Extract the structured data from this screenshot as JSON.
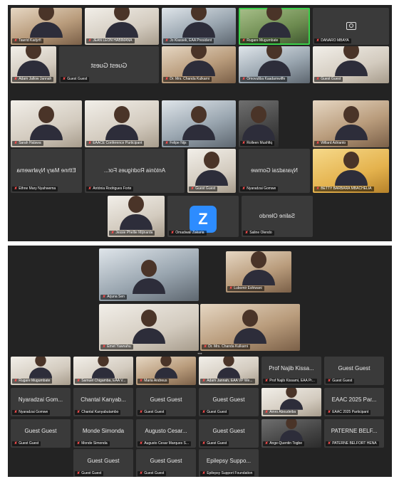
{
  "top_gallery": {
    "tiles": [
      {
        "name": "Tawrid Kadyrfi",
        "name_style": "video",
        "shade": "warm"
      },
      {
        "name": "JEAN LEON HABIMANA",
        "name_style": "video",
        "shade": "pale"
      },
      {
        "name": "Jo Klassek, EAA President",
        "name_style": "video",
        "shade": "cool"
      },
      {
        "name": "Rugare Mugumbate",
        "name_style": "video",
        "shade": "green",
        "active": true
      },
      {
        "name": "DANARO MBAYA",
        "name_style": "camera-off"
      },
      {
        "name": "Guest Guest",
        "name_style": "text-center"
      },
      {
        "name": "Adam Jallow Jannah",
        "name_style": "video",
        "shade": "pale"
      },
      {
        "name": "Dr. Mrs. Chanda Kulkarni",
        "name_style": "video",
        "shade": "warm"
      },
      {
        "name": "Omovuliba Kaadamwiffe",
        "name_style": "video",
        "shade": "cool"
      },
      {
        "name": "Guest Guest",
        "name_style": "video",
        "shade": "pale"
      },
      {
        "name": "Sarah Halawa",
        "name_style": "video",
        "shade": "pale"
      },
      {
        "name": "EAACE Conference Participant",
        "name_style": "video",
        "shade": "pale"
      },
      {
        "name": "Felipe Nijs",
        "name_style": "video",
        "shade": "cool"
      },
      {
        "name": "Rolleen Mushfiq",
        "name_style": "video",
        "shade": "dark"
      },
      {
        "name": "Willard Adrianto",
        "name_style": "video",
        "shade": "warm"
      },
      {
        "name": "Ethne Mary Nyahwema",
        "name_style": "text-center-mirror"
      },
      {
        "name": "Antónia Rodrigues Forte",
        "name_style": "text-center-mirror"
      },
      {
        "name": "Guest Guest",
        "name_style": "video",
        "shade": "pale"
      },
      {
        "name": "Nyaradzai Gomwe",
        "name_style": "text-center-mirror"
      },
      {
        "name": "BETTY BARBARA MBACHELIA",
        "name_style": "video",
        "shade": "yellow"
      },
      {
        "name": "Jessie Phellie Mijinarda",
        "name_style": "video",
        "shade": "pale"
      },
      {
        "name": "Omadwali Zakaria",
        "name_style": "zoom-avatar"
      },
      {
        "name": "Saline Olendo",
        "name_style": "text-center-mirror"
      }
    ],
    "big_text": {
      "guest_guest": "Guest Guest",
      "ethne": "Ethne Mary Nyahwema",
      "antonia": "Antónia Rodrigues For...",
      "nyaradzai": "Nyaradzai Gomwe",
      "saline": "Saline Olendo",
      "z_avatar": "Z"
    }
  },
  "bottom_gallery": {
    "speakers": [
      {
        "name": "Arjuna Sen",
        "shade": "cool"
      },
      {
        "name": "Lubomir Eshiwani",
        "shade": "warm"
      },
      {
        "name": "Emet Yawnahu",
        "shade": "pale"
      },
      {
        "name": "Dr. Mrs. Chanda Kulkarni",
        "shade": "warm"
      }
    ],
    "small_tiles": [
      {
        "name": "Rugare Mugumbate",
        "kind": "video",
        "shade": "pale"
      },
      {
        "name": "Samuel Chigamba, EAA V...",
        "kind": "video",
        "shade": "pale"
      },
      {
        "name": "Maria Andreus",
        "kind": "video",
        "shade": "warm"
      },
      {
        "name": "Adam Jannah, EAA VP We...",
        "kind": "video",
        "shade": "pale"
      },
      {
        "name": "Prof Najib Kissami, EAA Pr...",
        "kind": "text",
        "label": "Prof Najib Kissa..."
      },
      {
        "name": "Guest Guest",
        "kind": "text",
        "label": "Guest Guest"
      },
      {
        "name": "Nyaradzai Gomwe",
        "kind": "text",
        "label": "Nyaradzai Gom..."
      },
      {
        "name": "Chantal Kanyabutambo",
        "kind": "text",
        "label": "Chantal Kanyab..."
      },
      {
        "name": "Guest Guest",
        "kind": "text",
        "label": "Guest Guest"
      },
      {
        "name": "Guest Guest",
        "kind": "text",
        "label": "Guest Guest"
      },
      {
        "name": "Amro Aboudeiba",
        "kind": "video",
        "shade": "pale"
      },
      {
        "name": "EAAC 2025 Participant",
        "kind": "text",
        "label": "EAAC 2025 Par..."
      },
      {
        "name": "Guest Guest",
        "kind": "text",
        "label": "Guest Guest"
      },
      {
        "name": "Monde Simonda",
        "kind": "text",
        "label": "Monde Simonda"
      },
      {
        "name": "Augusto Cesar Marques S...",
        "kind": "text",
        "label": "Augusto Cesar..."
      },
      {
        "name": "Guest Guest",
        "kind": "text",
        "label": "Guest Guest"
      },
      {
        "name": "Ange-Quentin Togbe",
        "kind": "video",
        "shade": "dark"
      },
      {
        "name": "PATERNE BELFORT HENA",
        "kind": "text",
        "label": "PATERNE BELF..."
      },
      {
        "name": "Guest Guest",
        "kind": "text",
        "label": "Guest Guest"
      },
      {
        "name": "Guest Guest",
        "kind": "text",
        "label": "Guest Guest"
      },
      {
        "name": "Epilepsy Support Foundation",
        "kind": "text",
        "label": "Epilepsy Suppo..."
      }
    ]
  }
}
